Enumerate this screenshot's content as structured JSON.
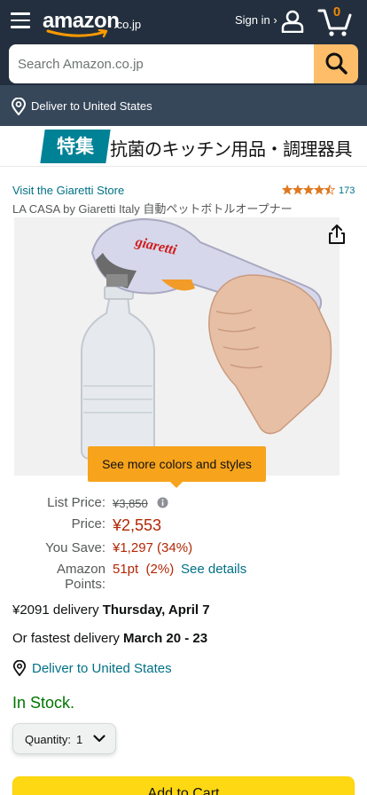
{
  "header": {
    "logo_word": "amazon",
    "logo_tld": ".co.jp",
    "signin": "Sign in ›",
    "cart_count": "0",
    "accent": "#febd69"
  },
  "search": {
    "placeholder": "Search Amazon.co.jp"
  },
  "location": {
    "deliver_text": "Deliver to United States"
  },
  "banner": {
    "tag": "特集",
    "text": "抗菌のキッチン用品・調理器具"
  },
  "product": {
    "store_link": "Visit the Giaretti Store",
    "rating": 4.5,
    "rating_count": "173",
    "title": "LA CASA by Giaretti Italy 自動ペットボトルオープナー",
    "brand_on_device": "giaretti",
    "colors_button": "See more colors and styles"
  },
  "pricing": {
    "list_label": "List Price:",
    "list_value": "¥3,850",
    "price_label": "Price:",
    "price_value": "¥2,553",
    "save_label": "You Save:",
    "save_value": "¥1,297 (34%)",
    "points_label": "Amazon Points:",
    "points_value": "51pt  (2%)",
    "see_details": "See details"
  },
  "delivery": {
    "line1_prefix": "¥2091 delivery ",
    "line1_date": "Thursday, April 7",
    "line2_prefix": "Or fastest delivery ",
    "line2_date": "March 20 - 23",
    "deliver_link": "Deliver to United States",
    "stock": "In Stock."
  },
  "quantity": {
    "label": "Quantity:",
    "value": "1"
  },
  "cart_button": "Add to Cart"
}
